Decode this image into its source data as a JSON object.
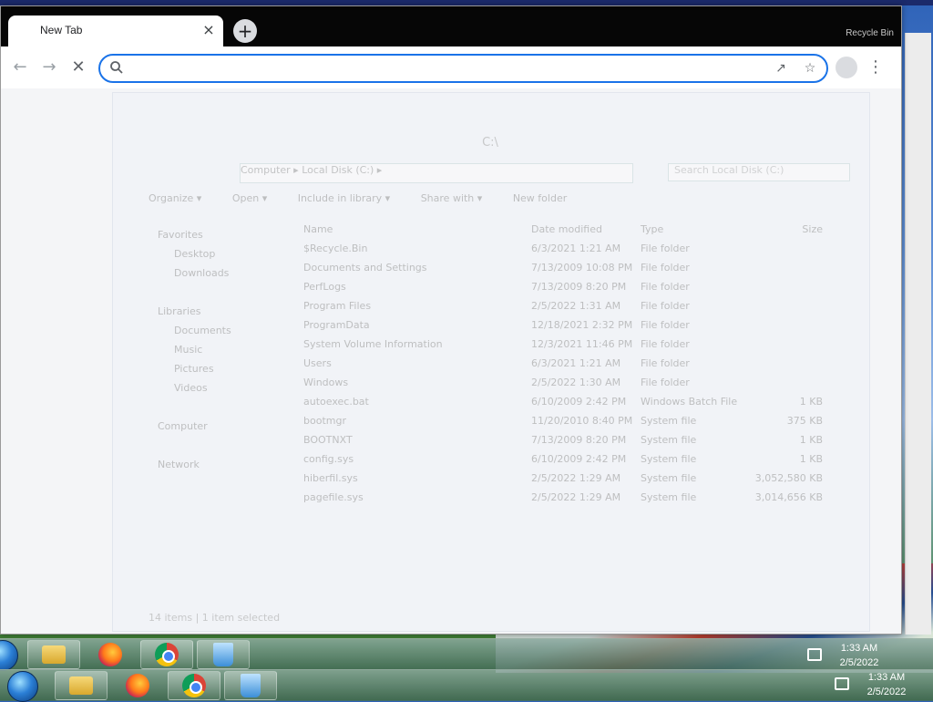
{
  "browser": {
    "tab_title": "New Tab",
    "tab_close": "×",
    "new_tab": "+",
    "window_label": "Recycle Bin",
    "address_value": "",
    "address_placeholder": "",
    "icons": {
      "back": "arrow-left-icon",
      "forward": "arrow-right-icon",
      "stop": "close-icon",
      "search": "search-icon",
      "share": "share-icon",
      "bookmark": "star-icon",
      "profile": "profile-icon",
      "menu": "kebab-menu-icon"
    },
    "accent": "#1a73e8"
  },
  "explorer": {
    "title": "C:\\",
    "address": "Computer  ▸  Local Disk (C:)  ▸",
    "search_placeholder": "Search Local Disk (C:)",
    "commands": [
      "Organize ▾",
      "Open ▾",
      "Include in library ▾",
      "Share with ▾",
      "New folder"
    ],
    "nav": [
      "Favorites",
      "Desktop",
      "Downloads",
      "",
      "Libraries",
      "Documents",
      "Music",
      "Pictures",
      "Videos",
      "",
      "Computer",
      "",
      "Network"
    ],
    "columns": [
      "Name",
      "Date modified",
      "Type",
      "Size"
    ],
    "rows": [
      {
        "name": "$Recycle.Bin",
        "date": "6/3/2021 1:21 AM",
        "type": "File folder",
        "size": ""
      },
      {
        "name": "Documents and Settings",
        "date": "7/13/2009 10:08 PM",
        "type": "File folder",
        "size": ""
      },
      {
        "name": "PerfLogs",
        "date": "7/13/2009 8:20 PM",
        "type": "File folder",
        "size": ""
      },
      {
        "name": "Program Files",
        "date": "2/5/2022 1:31 AM",
        "type": "File folder",
        "size": ""
      },
      {
        "name": "ProgramData",
        "date": "12/18/2021 2:32 PM",
        "type": "File folder",
        "size": ""
      },
      {
        "name": "System Volume Information",
        "date": "12/3/2021 11:46 PM",
        "type": "File folder",
        "size": ""
      },
      {
        "name": "Users",
        "date": "6/3/2021 1:21 AM",
        "type": "File folder",
        "size": ""
      },
      {
        "name": "Windows",
        "date": "2/5/2022 1:30 AM",
        "type": "File folder",
        "size": ""
      },
      {
        "name": "autoexec.bat",
        "date": "6/10/2009 2:42 PM",
        "type": "Windows Batch File",
        "size": "1 KB"
      },
      {
        "name": "bootmgr",
        "date": "11/20/2010 8:40 PM",
        "type": "System file",
        "size": "375 KB"
      },
      {
        "name": "BOOTNXT",
        "date": "7/13/2009 8:20 PM",
        "type": "System file",
        "size": "1 KB"
      },
      {
        "name": "config.sys",
        "date": "6/10/2009 2:42 PM",
        "type": "System file",
        "size": "1 KB"
      },
      {
        "name": "hiberfil.sys",
        "date": "2/5/2022 1:29 AM",
        "type": "System file",
        "size": "3,052,580 KB"
      },
      {
        "name": "pagefile.sys",
        "date": "2/5/2022 1:29 AM",
        "type": "System file",
        "size": "3,014,656 KB"
      }
    ],
    "status": "14 items   |   1 item selected"
  },
  "taskbar_upper": {
    "time": "1:33 AM",
    "date": "2/5/2022",
    "apps": [
      "folder-icon",
      "firefox-icon",
      "chrome-icon",
      "recycle-bin-icon"
    ]
  },
  "taskbar_lower": {
    "time": "1:33 AM",
    "date": "2/5/2022",
    "apps": [
      "folder-icon",
      "firefox-icon",
      "chrome-icon",
      "recycle-bin-icon"
    ]
  }
}
